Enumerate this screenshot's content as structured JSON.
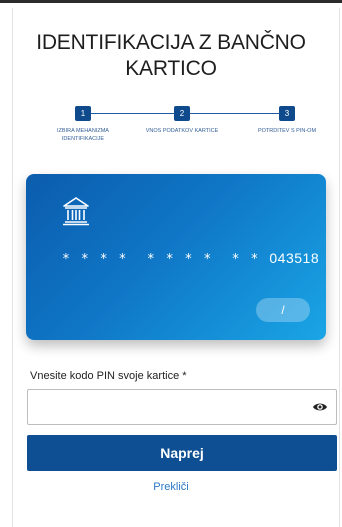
{
  "page": {
    "title_line1": "IDENTIFIKACIJA Z BANČNO",
    "title_line2": "KARTICO"
  },
  "steps": [
    {
      "number": "1",
      "label_line1": "IZBIRA MEHANIZMA",
      "label_line2": "IDENTIFIKACIJE"
    },
    {
      "number": "2",
      "label_line1": "VNOS PODATKOV KARTICE",
      "label_line2": ""
    },
    {
      "number": "3",
      "label_line1": "POTRDITEV S PIN-OM",
      "label_line2": ""
    }
  ],
  "card": {
    "masked_prefix": "**** **** **",
    "last_digits": "043518",
    "expiry": "/",
    "icon": "bank-icon"
  },
  "pin": {
    "label": "Vnesite kodo PIN svoje kartice *",
    "value": "",
    "placeholder": "",
    "toggle_icon": "eye-icon"
  },
  "actions": {
    "next_label": "Naprej",
    "cancel_label": "Prekliči"
  },
  "colors": {
    "primary": "#0d4f92",
    "link": "#2b78c7",
    "card_gradient_start": "#0c5cad",
    "card_gradient_end": "#1aa5e6"
  }
}
